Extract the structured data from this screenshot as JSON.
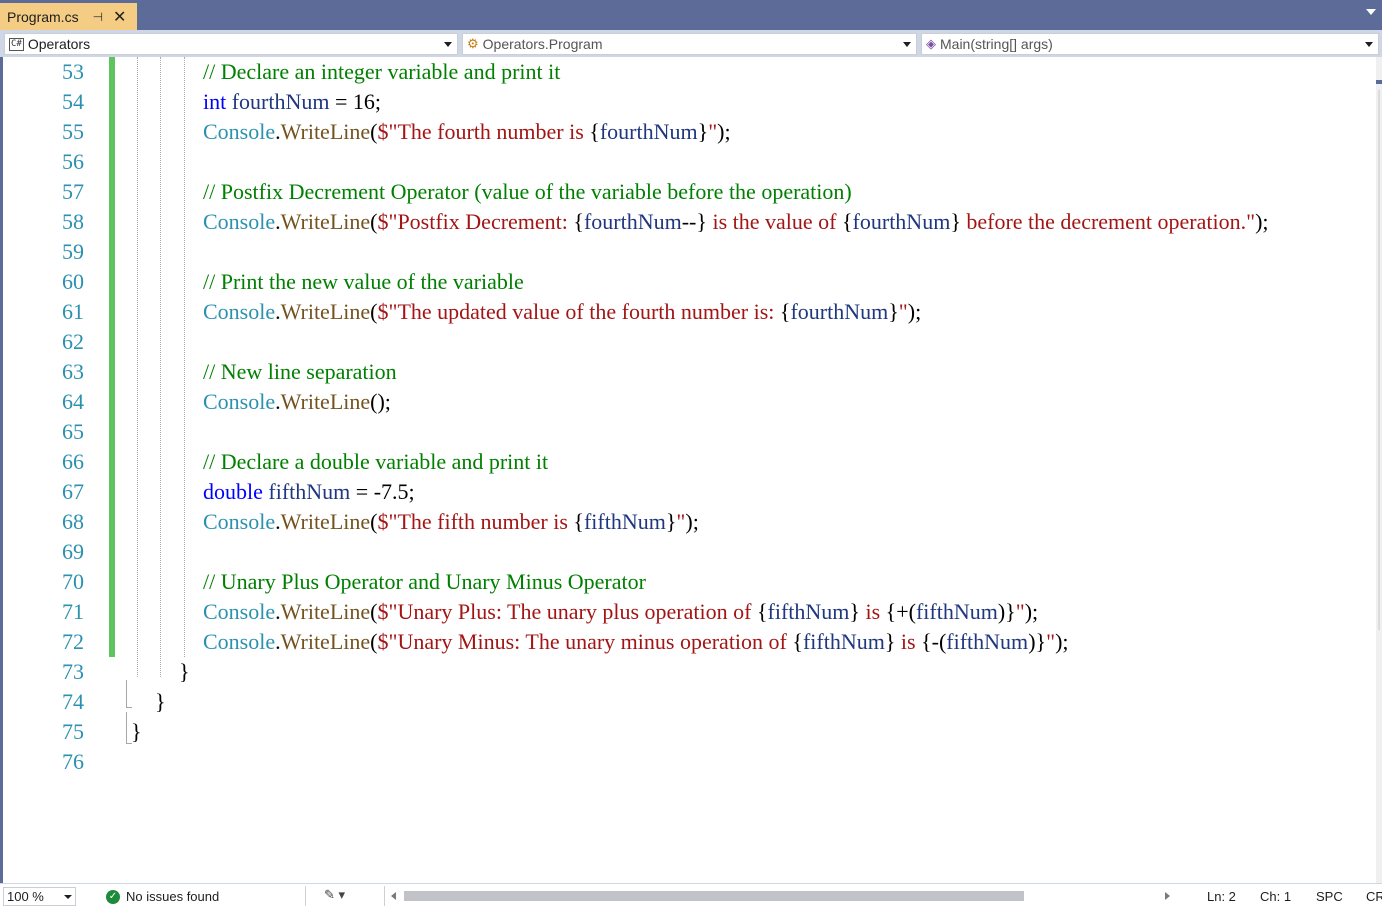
{
  "tab": {
    "label": "Program.cs",
    "pin_glyph": "⊣",
    "close_glyph": "✕"
  },
  "navbar": {
    "project": "Operators",
    "project_icon": "C#",
    "type": "Operators.Program",
    "member": "Main(string[] args)"
  },
  "editor": {
    "line_numbers": [
      "53",
      "54",
      "55",
      "56",
      "57",
      "58",
      "59",
      "60",
      "61",
      "62",
      "63",
      "64",
      "65",
      "66",
      "67",
      "68",
      "69",
      "70",
      "71",
      "72",
      "73",
      "74",
      "75",
      "76"
    ],
    "lines": [
      [
        {
          "c": "cmt",
          "t": "// Declare an integer variable and print it"
        }
      ],
      [
        {
          "c": "kw",
          "t": "int"
        },
        {
          "c": "par",
          "t": " "
        },
        {
          "c": "var",
          "t": "fourthNum"
        },
        {
          "c": "par",
          "t": " = 16;"
        }
      ],
      [
        {
          "c": "type",
          "t": "Console"
        },
        {
          "c": "par",
          "t": "."
        },
        {
          "c": "meth",
          "t": "WriteLine"
        },
        {
          "c": "par",
          "t": "("
        },
        {
          "c": "str",
          "t": "$\"The fourth number is "
        },
        {
          "c": "par",
          "t": "{"
        },
        {
          "c": "var",
          "t": "fourthNum"
        },
        {
          "c": "par",
          "t": "}"
        },
        {
          "c": "str",
          "t": "\""
        },
        {
          "c": "par",
          "t": ");"
        }
      ],
      [],
      [
        {
          "c": "cmt",
          "t": "// Postfix Decrement Operator (value of the variable before the operation)"
        }
      ],
      [
        {
          "c": "type",
          "t": "Console"
        },
        {
          "c": "par",
          "t": "."
        },
        {
          "c": "meth",
          "t": "WriteLine"
        },
        {
          "c": "par",
          "t": "("
        },
        {
          "c": "str",
          "t": "$\"Postfix Decrement: "
        },
        {
          "c": "par",
          "t": "{"
        },
        {
          "c": "var",
          "t": "fourthNum"
        },
        {
          "c": "par",
          "t": "--}"
        },
        {
          "c": "str",
          "t": " is the value of "
        },
        {
          "c": "par",
          "t": "{"
        },
        {
          "c": "var",
          "t": "fourthNum"
        },
        {
          "c": "par",
          "t": "}"
        },
        {
          "c": "str",
          "t": " before the decrement operation.\""
        },
        {
          "c": "par",
          "t": ");"
        }
      ],
      [],
      [
        {
          "c": "cmt",
          "t": "// Print the new value of the variable"
        }
      ],
      [
        {
          "c": "type",
          "t": "Console"
        },
        {
          "c": "par",
          "t": "."
        },
        {
          "c": "meth",
          "t": "WriteLine"
        },
        {
          "c": "par",
          "t": "("
        },
        {
          "c": "str",
          "t": "$\"The updated value of the fourth number is: "
        },
        {
          "c": "par",
          "t": "{"
        },
        {
          "c": "var",
          "t": "fourthNum"
        },
        {
          "c": "par",
          "t": "}"
        },
        {
          "c": "str",
          "t": "\""
        },
        {
          "c": "par",
          "t": ");"
        }
      ],
      [],
      [
        {
          "c": "cmt",
          "t": "// New line separation"
        }
      ],
      [
        {
          "c": "type",
          "t": "Console"
        },
        {
          "c": "par",
          "t": "."
        },
        {
          "c": "meth",
          "t": "WriteLine"
        },
        {
          "c": "par",
          "t": "();"
        }
      ],
      [],
      [
        {
          "c": "cmt",
          "t": "// Declare a double variable and print it"
        }
      ],
      [
        {
          "c": "kw",
          "t": "double"
        },
        {
          "c": "par",
          "t": " "
        },
        {
          "c": "var",
          "t": "fifthNum"
        },
        {
          "c": "par",
          "t": " = -7.5;"
        }
      ],
      [
        {
          "c": "type",
          "t": "Console"
        },
        {
          "c": "par",
          "t": "."
        },
        {
          "c": "meth",
          "t": "WriteLine"
        },
        {
          "c": "par",
          "t": "("
        },
        {
          "c": "str",
          "t": "$\"The fifth number is "
        },
        {
          "c": "par",
          "t": "{"
        },
        {
          "c": "var",
          "t": "fifthNum"
        },
        {
          "c": "par",
          "t": "}"
        },
        {
          "c": "str",
          "t": "\""
        },
        {
          "c": "par",
          "t": ");"
        }
      ],
      [],
      [
        {
          "c": "cmt",
          "t": "// Unary Plus Operator and Unary Minus Operator"
        }
      ],
      [
        {
          "c": "type",
          "t": "Console"
        },
        {
          "c": "par",
          "t": "."
        },
        {
          "c": "meth",
          "t": "WriteLine"
        },
        {
          "c": "par",
          "t": "("
        },
        {
          "c": "str",
          "t": "$\"Unary Plus: The unary plus operation of "
        },
        {
          "c": "par",
          "t": "{"
        },
        {
          "c": "var",
          "t": "fifthNum"
        },
        {
          "c": "par",
          "t": "}"
        },
        {
          "c": "str",
          "t": " is "
        },
        {
          "c": "par",
          "t": "{+("
        },
        {
          "c": "var",
          "t": "fifthNum"
        },
        {
          "c": "par",
          "t": ")}"
        },
        {
          "c": "str",
          "t": "\""
        },
        {
          "c": "par",
          "t": ");"
        }
      ],
      [
        {
          "c": "type",
          "t": "Console"
        },
        {
          "c": "par",
          "t": "."
        },
        {
          "c": "meth",
          "t": "WriteLine"
        },
        {
          "c": "par",
          "t": "("
        },
        {
          "c": "str",
          "t": "$\"Unary Minus: The unary minus operation of "
        },
        {
          "c": "par",
          "t": "{"
        },
        {
          "c": "var",
          "t": "fifthNum"
        },
        {
          "c": "par",
          "t": "}"
        },
        {
          "c": "str",
          "t": " is "
        },
        {
          "c": "par",
          "t": "{-("
        },
        {
          "c": "var",
          "t": "fifthNum"
        },
        {
          "c": "par",
          "t": ")}"
        },
        {
          "c": "str",
          "t": "\""
        },
        {
          "c": "par",
          "t": ");"
        }
      ],
      [
        {
          "c": "par",
          "t": "}"
        }
      ],
      [
        {
          "c": "par",
          "t": "}"
        }
      ],
      [
        {
          "c": "par",
          "t": "}"
        }
      ],
      []
    ]
  },
  "statusbar": {
    "zoom": "100 %",
    "issues": "No issues found",
    "line": "Ln: 2",
    "char": "Ch: 1",
    "whitespace": "SPC",
    "line_ending": "CR"
  },
  "colors": {
    "comment": "#008000",
    "keyword": "#0000ff",
    "type": "#2b91af",
    "method": "#74531f",
    "string": "#a31515",
    "variable": "#1f377f",
    "change_bar": "#5fc45f",
    "tab_active": "#f5cc84",
    "chrome": "#5d6b99"
  }
}
